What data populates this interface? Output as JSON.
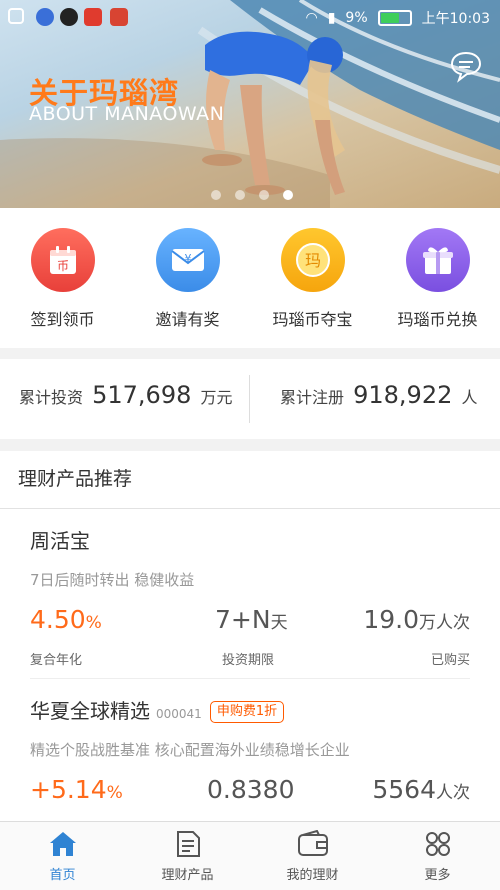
{
  "status_bar": {
    "battery": "9%",
    "time": "上午10:03"
  },
  "banner": {
    "title": "关于玛瑙湾",
    "subtitle": "ABOUT MANAOWAN",
    "dot_count": 4,
    "active_dot": 3
  },
  "quick_actions": [
    {
      "label": "签到领币",
      "icon": "calendar-coin-icon",
      "glyph": "币",
      "color": "#f0524d"
    },
    {
      "label": "邀请有奖",
      "icon": "envelope-icon",
      "glyph": "¥",
      "color": "#4a9bf0"
    },
    {
      "label": "玛瑙币夺宝",
      "icon": "coin-icon",
      "glyph": "玛",
      "color": "#f9b21b"
    },
    {
      "label": "玛瑙币兑换",
      "icon": "gift-icon",
      "glyph": "",
      "color": "#8c5ee8"
    }
  ],
  "stats": {
    "invest_label": "累计投资",
    "invest_value": "517,698",
    "invest_unit": "万元",
    "register_label": "累计注册",
    "register_value": "918,922",
    "register_unit": "人"
  },
  "recommend": {
    "title": "理财产品推荐",
    "products": [
      {
        "name": "周活宝",
        "code": "",
        "badge": "",
        "desc": "7日后随时转出 稳健收益",
        "rate": "4.50",
        "rate_unit": "%",
        "rate_label": "复合年化",
        "term": "7+N",
        "term_unit": "天",
        "term_label": "投资期限",
        "buyers": "19.0",
        "buyers_unit": "万人次",
        "buyers_label": "已购买"
      },
      {
        "name": "华夏全球精选",
        "code": "000041",
        "badge": "申购费1折",
        "desc": "精选个股战胜基准 核心配置海外业绩稳增长企业",
        "rate": "+5.14",
        "rate_unit": "%",
        "nav": "0.8380",
        "buyers": "5564",
        "buyers_unit": "人次"
      }
    ]
  },
  "tabs": [
    {
      "label": "首页",
      "icon": "home-icon",
      "active": true
    },
    {
      "label": "理财产品",
      "icon": "document-icon",
      "active": false
    },
    {
      "label": "我的理财",
      "icon": "wallet-icon",
      "active": false
    },
    {
      "label": "更多",
      "icon": "grid-icon",
      "active": false
    }
  ]
}
